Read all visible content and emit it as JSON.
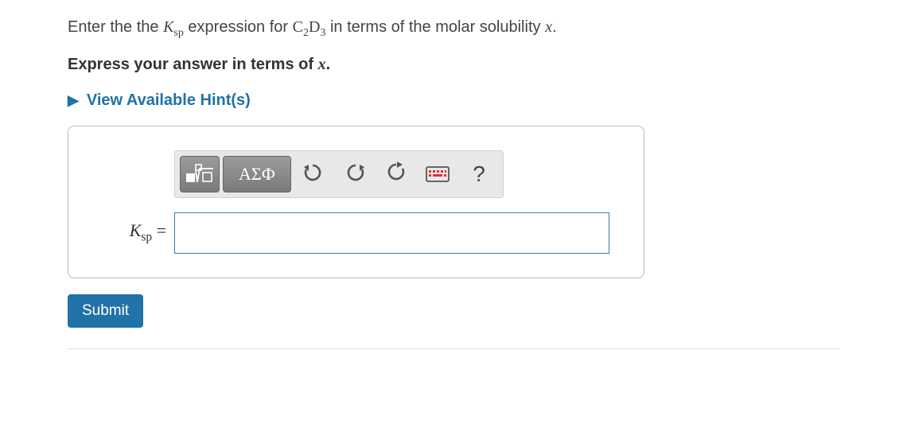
{
  "question": {
    "prefix": "Enter the the ",
    "ksp_var": "K",
    "ksp_sub": "sp",
    "mid1": " expression for ",
    "compound_c": "C",
    "compound_c_sub": "2",
    "compound_d": "D",
    "compound_d_sub": "3",
    "mid2": " in terms of the molar solubility ",
    "var": "x",
    "suffix": "."
  },
  "instruction": {
    "prefix": "Express your answer in terms of ",
    "var": "x",
    "suffix": "."
  },
  "hints": {
    "label": "View Available Hint(s)"
  },
  "toolbar": {
    "math_format": "math-templates",
    "greek": "ΑΣФ",
    "undo": "undo",
    "redo": "redo",
    "reset": "reset",
    "keyboard": "keyboard",
    "help": "?"
  },
  "answer": {
    "label_var": "K",
    "label_sub": "sp",
    "label_eq": " =",
    "value": ""
  },
  "submit": {
    "label": "Submit"
  }
}
